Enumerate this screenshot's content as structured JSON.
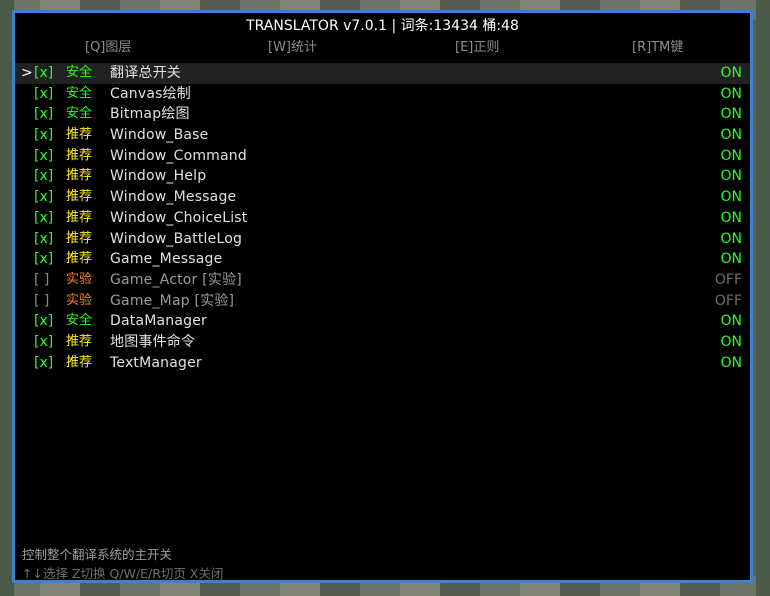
{
  "window": {
    "title": "TRANSLATOR v7.0.1 | 词条:13434 桶:48"
  },
  "tabs": [
    {
      "label": "[Q]图层",
      "active": true
    },
    {
      "label": "[W]统计",
      "active": false
    },
    {
      "label": "[E]正则",
      "active": false
    },
    {
      "label": "[R]TM键",
      "active": false
    }
  ],
  "cursor_glyph": ">",
  "items": [
    {
      "check": "[x]",
      "category": "安全",
      "name": "翻译总开关",
      "state": "ON"
    },
    {
      "check": "[x]",
      "category": "安全",
      "name": "Canvas绘制",
      "state": "ON"
    },
    {
      "check": "[x]",
      "category": "安全",
      "name": "Bitmap绘图",
      "state": "ON"
    },
    {
      "check": "[x]",
      "category": "推荐",
      "name": "Window_Base",
      "state": "ON"
    },
    {
      "check": "[x]",
      "category": "推荐",
      "name": "Window_Command",
      "state": "ON"
    },
    {
      "check": "[x]",
      "category": "推荐",
      "name": "Window_Help",
      "state": "ON"
    },
    {
      "check": "[x]",
      "category": "推荐",
      "name": "Window_Message",
      "state": "ON"
    },
    {
      "check": "[x]",
      "category": "推荐",
      "name": "Window_ChoiceList",
      "state": "ON"
    },
    {
      "check": "[x]",
      "category": "推荐",
      "name": "Window_BattleLog",
      "state": "ON"
    },
    {
      "check": "[x]",
      "category": "推荐",
      "name": "Game_Message",
      "state": "ON"
    },
    {
      "check": "[ ]",
      "category": "实验",
      "name": "Game_Actor [实验]",
      "state": "OFF"
    },
    {
      "check": "[ ]",
      "category": "实验",
      "name": "Game_Map [实验]",
      "state": "OFF"
    },
    {
      "check": "[x]",
      "category": "安全",
      "name": "DataManager",
      "state": "ON"
    },
    {
      "check": "[x]",
      "category": "推荐",
      "name": "地图事件命令",
      "state": "ON"
    },
    {
      "check": "[x]",
      "category": "推荐",
      "name": "TextManager",
      "state": "ON"
    }
  ],
  "footer": {
    "description": "控制整个翻译系统的主开关",
    "hint": "↑↓选择 Z切换 Q/W/E/R切页 X关闭"
  },
  "colors": {
    "border": "#3f82c9",
    "on": "#22ff22",
    "safe": "#22ff22",
    "recommended": "#ffee22",
    "experimental": "#ff7a1a",
    "off": "#6e6e6e"
  }
}
